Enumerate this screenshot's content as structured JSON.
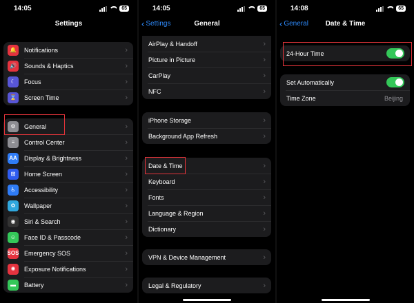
{
  "panels": {
    "settings": {
      "time": "14:05",
      "battery": "65",
      "title": "Settings",
      "group1": [
        {
          "label": "Notifications",
          "icon": "bell-icon",
          "color": "#e5333f",
          "glyph": "🔔"
        },
        {
          "label": "Sounds & Haptics",
          "icon": "speaker-icon",
          "color": "#e5333f",
          "glyph": "🔊"
        },
        {
          "label": "Focus",
          "icon": "moon-icon",
          "color": "#5856d6",
          "glyph": "☾"
        },
        {
          "label": "Screen Time",
          "icon": "hourglass-icon",
          "color": "#5856d6",
          "glyph": "⌛"
        }
      ],
      "group2": [
        {
          "label": "General",
          "icon": "gear-icon",
          "color": "#8e8e93",
          "glyph": "⚙"
        },
        {
          "label": "Control Center",
          "icon": "switches-icon",
          "color": "#8e8e93",
          "glyph": "≡"
        },
        {
          "label": "Display & Brightness",
          "icon": "text-size-icon",
          "color": "#2f7cf6",
          "glyph": "AA"
        },
        {
          "label": "Home Screen",
          "icon": "grid-icon",
          "color": "#2f5cf0",
          "glyph": "⊞"
        },
        {
          "label": "Accessibility",
          "icon": "accessibility-icon",
          "color": "#2f7cf6",
          "glyph": "♿"
        },
        {
          "label": "Wallpaper",
          "icon": "flower-icon",
          "color": "#30a8de",
          "glyph": "✿"
        },
        {
          "label": "Siri & Search",
          "icon": "siri-icon",
          "color": "#333",
          "glyph": "◉"
        },
        {
          "label": "Face ID & Passcode",
          "icon": "face-id-icon",
          "color": "#34c759",
          "glyph": "☺"
        },
        {
          "label": "Emergency SOS",
          "icon": "sos-icon",
          "color": "#e5333f",
          "glyph": "SOS"
        },
        {
          "label": "Exposure Notifications",
          "icon": "exposure-icon",
          "color": "#e5333f",
          "glyph": "✺"
        },
        {
          "label": "Battery",
          "icon": "battery-icon",
          "color": "#34c759",
          "glyph": "▬"
        }
      ]
    },
    "general": {
      "time": "14:05",
      "battery": "65",
      "title": "General",
      "back": "Settings",
      "group1": [
        "AirPlay & Handoff",
        "Picture in Picture",
        "CarPlay",
        "NFC"
      ],
      "group2": [
        "iPhone Storage",
        "Background App Refresh"
      ],
      "group3": [
        "Date & Time",
        "Keyboard",
        "Fonts",
        "Language & Region",
        "Dictionary"
      ],
      "group4": [
        "VPN & Device Management"
      ],
      "group5": [
        "Legal & Regulatory"
      ]
    },
    "datetime": {
      "time": "14:08",
      "battery": "65",
      "title": "Date & Time",
      "back": "General",
      "hour24": {
        "label": "24-Hour Time",
        "on": true
      },
      "set_auto": {
        "label": "Set Automatically",
        "on": true
      },
      "time_zone": {
        "label": "Time Zone",
        "value": "Beijing"
      }
    }
  },
  "colors": {
    "accent": "#2f8cff",
    "toggle_on": "#34c759",
    "highlight": "#e3343a",
    "cell": "#1c1c1e"
  }
}
